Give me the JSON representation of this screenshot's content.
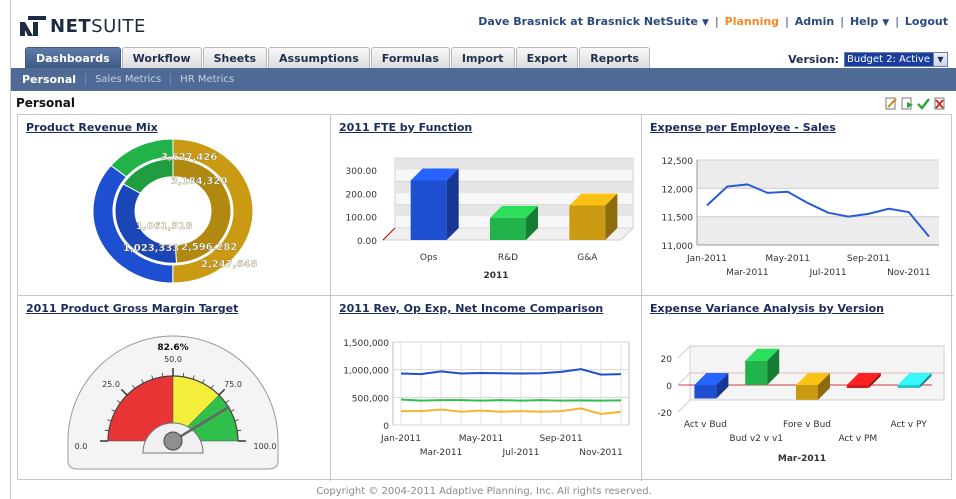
{
  "header": {
    "logo_text_bold": "NET",
    "logo_text_light": "SUITE",
    "user": "Dave Brasnick at Brasnick NetSuite",
    "links": [
      "Planning",
      "Admin",
      "Help",
      "Logout"
    ]
  },
  "tabs": [
    "Dashboards",
    "Workflow",
    "Sheets",
    "Assumptions",
    "Formulas",
    "Import",
    "Export",
    "Reports"
  ],
  "version": {
    "label": "Version:",
    "value": "Budget 2: Active"
  },
  "subnav": [
    "Personal",
    "Sales Metrics",
    "HR Metrics"
  ],
  "page_title": "Personal",
  "toolbar_icons": [
    "edit-icon",
    "export-icon",
    "check-icon",
    "delete-icon"
  ],
  "colors": {
    "tab_active": "#4a658f",
    "subnav": "#4f6b95",
    "accent": "#f08a24",
    "blue": "#1f4fd1",
    "green": "#22b24a",
    "gold": "#c99a12"
  },
  "panels": {
    "p1": {
      "title": "Product Revenue Mix"
    },
    "p2": {
      "title": "2011 FTE by Function"
    },
    "p3": {
      "title": "Expense per Employee - Sales"
    },
    "p4": {
      "title": "2011 Product Gross Margin Target"
    },
    "p5": {
      "title": "2011 Rev, Op Exp, Net Income Comparison"
    },
    "p6": {
      "title": "Expense Variance Analysis by Version"
    }
  },
  "footer": "Copyright © 2004-2011 Adaptive Planning, Inc. All rights reserved.",
  "chart_data": [
    {
      "type": "pie",
      "title": "Product Revenue Mix",
      "subtype": "doughnut",
      "series": [
        {
          "name": "outer",
          "values": [
            3627426,
            2596282,
            1023333
          ]
        },
        {
          "name": "inner",
          "values": [
            3184320,
            2247648,
            1061518
          ]
        }
      ],
      "labels": [
        "3,627,426",
        "3,184,320",
        "1,061,518",
        "1,023,333",
        "2,596,282",
        "2,247,648"
      ],
      "colors": [
        "#c99a12",
        "#1f4fd1",
        "#22b24a"
      ]
    },
    {
      "type": "bar",
      "title": "2011 FTE by Function",
      "categories": [
        "Ops",
        "R&D",
        "G&A"
      ],
      "values": [
        255,
        95,
        148
      ],
      "xlabel": "2011",
      "ylim": [
        0,
        300
      ],
      "yticks": [
        "0.00",
        "100.00",
        "200.00",
        "300.00"
      ],
      "colors": [
        "#1f4fd1",
        "#22b24a",
        "#c99a12"
      ]
    },
    {
      "type": "line",
      "title": "Expense per Employee - Sales",
      "x": [
        "Jan-2011",
        "Feb-2011",
        "Mar-2011",
        "Apr-2011",
        "May-2011",
        "Jun-2011",
        "Jul-2011",
        "Aug-2011",
        "Sep-2011",
        "Oct-2011",
        "Nov-2011",
        "Dec-2011"
      ],
      "values": [
        11700,
        12030,
        12070,
        11920,
        11940,
        11740,
        11570,
        11500,
        11550,
        11640,
        11580,
        11150
      ],
      "ylim": [
        11000,
        12500
      ],
      "yticks": [
        "11,000",
        "11,500",
        "12,000",
        "12,500"
      ],
      "xticks_top": [
        "Jan-2011",
        "May-2011",
        "Sep-2011"
      ],
      "xticks_bottom": [
        "Mar-2011",
        "Jul-2011",
        "Nov-2011"
      ]
    },
    {
      "type": "gauge",
      "title": "2011 Product Gross Margin Target",
      "value": 82.6,
      "value_label": "82.6%",
      "range": [
        0,
        100
      ],
      "tick_labels": [
        "0.0",
        "25.0",
        "50.0",
        "75.0",
        "100.0"
      ],
      "bands": [
        {
          "from": 0,
          "to": 50,
          "color": "#e83434"
        },
        {
          "from": 50,
          "to": 75,
          "color": "#f2ee3a"
        },
        {
          "from": 75,
          "to": 100,
          "color": "#2fbf4a"
        }
      ]
    },
    {
      "type": "line",
      "title": "2011 Rev, Op Exp, Net Income Comparison",
      "x": [
        "Jan-2011",
        "Feb-2011",
        "Mar-2011",
        "Apr-2011",
        "May-2011",
        "Jun-2011",
        "Jul-2011",
        "Aug-2011",
        "Sep-2011",
        "Oct-2011",
        "Nov-2011",
        "Dec-2011"
      ],
      "series": [
        {
          "values": [
            930000,
            920000,
            970000,
            930000,
            940000,
            935000,
            930000,
            935000,
            960000,
            1010000,
            910000,
            920000
          ],
          "color": "#1f4fd1"
        },
        {
          "values": [
            460000,
            440000,
            450000,
            450000,
            440000,
            450000,
            440000,
            450000,
            440000,
            445000,
            440000,
            445000
          ],
          "color": "#2fbf4a"
        },
        {
          "values": [
            250000,
            250000,
            280000,
            240000,
            260000,
            240000,
            250000,
            240000,
            250000,
            300000,
            200000,
            240000
          ],
          "color": "#f2b632"
        }
      ],
      "ylim": [
        0,
        1500000
      ],
      "yticks": [
        "0",
        "500,000",
        "1,000,000",
        "1,500,000"
      ],
      "xticks_top": [
        "Jan-2011",
        "May-2011",
        "Sep-2011"
      ],
      "xticks_bottom": [
        "Mar-2011",
        "Jul-2011",
        "Nov-2011"
      ]
    },
    {
      "type": "bar",
      "title": "Expense Variance Analysis by Version",
      "categories": [
        "Act v Bud",
        "Bud v2 v v1",
        "Fore v Bud",
        "Act v PM",
        "Act v PY"
      ],
      "values": [
        -10,
        18,
        -11,
        -2,
        -2
      ],
      "xlabel": "Mar-2011",
      "ylim": [
        -20,
        20
      ],
      "yticks": [
        "-20",
        "0",
        "20"
      ],
      "colors": [
        "#1f4fd1",
        "#22b24a",
        "#c99a12",
        "#d21c1c",
        "#2bc6c9"
      ]
    }
  ]
}
